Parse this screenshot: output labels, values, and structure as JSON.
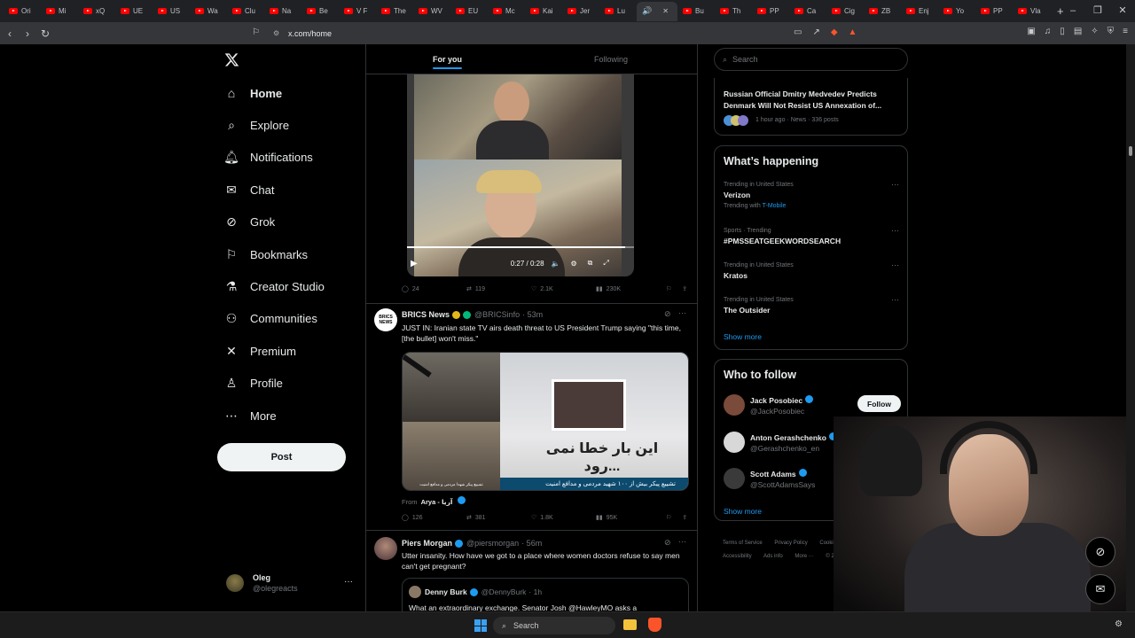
{
  "browser": {
    "tabs": [
      "Ori",
      "Mi",
      "xQ",
      "UE",
      "US",
      "Wa",
      "Clu",
      "Na",
      "Be",
      "V F",
      "The",
      "WV",
      "EU",
      "Mc",
      "Kai",
      "Jer",
      "Lu",
      "",
      "Bu",
      "Th",
      "PP",
      "Ca",
      "Cig",
      "ZB",
      "Enj",
      "Yo",
      "PP",
      "Vla"
    ],
    "new_tab": "+",
    "url": "x.com/home",
    "window_controls": [
      "–",
      "❐",
      "✕"
    ]
  },
  "nav": {
    "items": [
      {
        "label": "Home",
        "icon": "home-icon"
      },
      {
        "label": "Explore",
        "icon": "search-icon"
      },
      {
        "label": "Notifications",
        "icon": "bell-icon"
      },
      {
        "label": "Chat",
        "icon": "mail-icon"
      },
      {
        "label": "Grok",
        "icon": "grok-icon"
      },
      {
        "label": "Bookmarks",
        "icon": "bookmark-icon"
      },
      {
        "label": "Creator Studio",
        "icon": "flask-icon"
      },
      {
        "label": "Communities",
        "icon": "people-icon"
      },
      {
        "label": "Premium",
        "icon": "x-logo-icon"
      },
      {
        "label": "Profile",
        "icon": "person-icon"
      },
      {
        "label": "More",
        "icon": "more-circle-icon"
      }
    ],
    "post_label": "Post",
    "profile_name": "Oleg",
    "profile_handle": "@olegreacts",
    "profile_more": "···"
  },
  "timeline": {
    "tabs": {
      "for_you": "For you",
      "following": "Following"
    },
    "video": {
      "time": "0:27 / 0:28",
      "progress": 0.96
    },
    "tweet1_actions": {
      "replies": "24",
      "reposts": "119",
      "likes": "2.1K",
      "views": "230K"
    },
    "tweet2": {
      "name": "BRICS News",
      "handle": "@BRICSinfo",
      "time": "· 53m",
      "text": "JUST IN: Iranian state TV airs death threat to US President Trump saying \"this time, [the bullet] won't miss.\"",
      "avatar_text": "BRICS NEWS",
      "media_banner": "تشییع پیکر بیش از ۱۰۰ شهید مردمی و مدافع امنیت",
      "media_sign": "این بار خطا نمی رود...",
      "media_caption_left": "تشییع پیکر شهدا مردمی و مدافع امنیت",
      "from_prefix": "From",
      "from_name": "Arya - آریا",
      "actions": {
        "replies": "126",
        "reposts": "381",
        "likes": "1.8K",
        "views": "95K"
      },
      "more": "···"
    },
    "tweet3": {
      "name": "Piers Morgan",
      "handle": "@piersmorgan",
      "time": "· 56m",
      "text": "Utter insanity. How have we got to a place where women doctors refuse to say men can't get pregnant?",
      "quote_name": "Denny Burk",
      "quote_handle": "@DennyBurk",
      "quote_time": "· 1h",
      "quote_text": "What an extraordinary exchange. Senator Josh @HawleyMO asks a",
      "more": "···"
    }
  },
  "sidebar": {
    "search_placeholder": "Search",
    "top_story": {
      "title": "Russian Official Dmitry Medvedev Predicts Denmark Will Not Resist US Annexation of...",
      "meta": "1 hour ago · News · 336 posts"
    },
    "whats_happening": {
      "title": "What’s happening",
      "trends": [
        {
          "context": "Trending in United States",
          "title": "Verizon",
          "with_prefix": "Trending with",
          "with": "T-Mobile"
        },
        {
          "context": "Sports · Trending",
          "title": "#PMSSEATGEEKWORDSEARCH"
        },
        {
          "context": "Trending in United States",
          "title": "Kratos"
        },
        {
          "context": "Trending in United States",
          "title": "The Outsider"
        }
      ],
      "show_more": "Show more"
    },
    "who_to_follow": {
      "title": "Who to follow",
      "users": [
        {
          "name": "Jack Posobiec",
          "handle": "@JackPosobiec"
        },
        {
          "name": "Anton Gerashchenko",
          "handle": "@Gerashchenko_en"
        },
        {
          "name": "Scott Adams",
          "handle": "@ScottAdamsSays"
        }
      ],
      "follow_label": "Follow",
      "show_more": "Show more"
    },
    "footer": {
      "line1": [
        "Terms of Service",
        "Privacy Policy",
        "Cookie Policy"
      ],
      "line2": [
        "Accessibility",
        "Ads info",
        "More ···",
        "© 2026"
      ]
    }
  },
  "taskbar": {
    "search": "Search"
  }
}
